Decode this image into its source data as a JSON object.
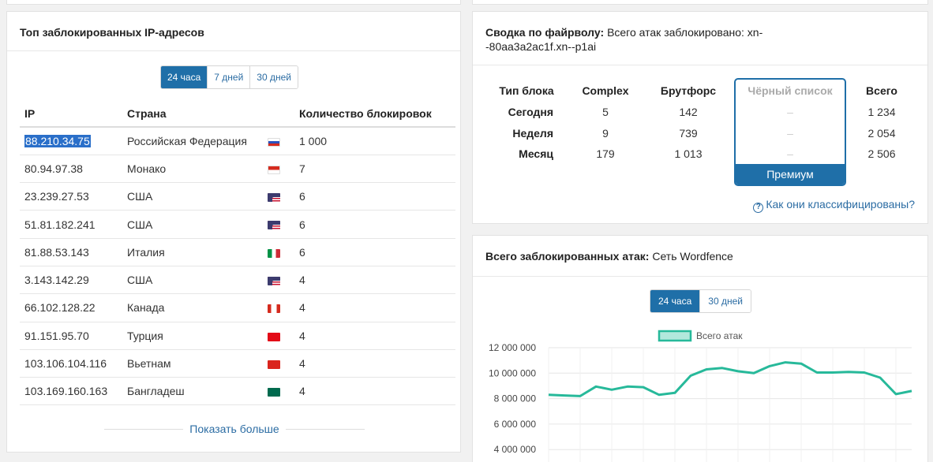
{
  "left_card": {
    "title": "Топ заблокированных IP-адресов",
    "range_tabs": [
      "24 часа",
      "7 дней",
      "30 дней"
    ],
    "active_tab": 0,
    "columns": [
      "IP",
      "Страна",
      "Количество блокировок"
    ],
    "rows": [
      {
        "ip": "88.210.34.75",
        "country": "Российская Федерация",
        "flag": "ru",
        "count": "1 000"
      },
      {
        "ip": "80.94.97.38",
        "country": "Монако",
        "flag": "mc",
        "count": "7"
      },
      {
        "ip": "23.239.27.53",
        "country": "США",
        "flag": "us",
        "count": "6"
      },
      {
        "ip": "51.81.182.241",
        "country": "США",
        "flag": "us",
        "count": "6"
      },
      {
        "ip": "81.88.53.143",
        "country": "Италия",
        "flag": "it",
        "count": "6"
      },
      {
        "ip": "3.143.142.29",
        "country": "США",
        "flag": "us",
        "count": "4"
      },
      {
        "ip": "66.102.128.22",
        "country": "Канада",
        "flag": "ca",
        "count": "4"
      },
      {
        "ip": "91.151.95.70",
        "country": "Турция",
        "flag": "tr",
        "count": "4"
      },
      {
        "ip": "103.106.104.116",
        "country": "Вьетнам",
        "flag": "vn",
        "count": "4"
      },
      {
        "ip": "103.169.160.163",
        "country": "Бангладеш",
        "flag": "bd",
        "count": "4"
      }
    ],
    "show_more": "Показать больше"
  },
  "firewall": {
    "title_bold": "Сводка по файрволу:",
    "title_rest": "Всего атак заблокировано: xn--80aa3a2ac1f.xn--p1ai",
    "title_line1": "Всего атак заблокировано: xn-",
    "title_line2": "-80aa3a2ac1f.xn--p1ai",
    "headers": [
      "Тип блока",
      "Complex",
      "Брутфорс",
      "Чёрный список",
      "Всего"
    ],
    "rows": [
      {
        "label": "Сегодня",
        "complex": "5",
        "brute": "142",
        "blacklist": "–",
        "total": "1 234"
      },
      {
        "label": "Неделя",
        "complex": "9",
        "brute": "739",
        "blacklist": "–",
        "total": "2 054"
      },
      {
        "label": "Месяц",
        "complex": "179",
        "brute": "1 013",
        "blacklist": "–",
        "total": "2 506"
      }
    ],
    "premium_label": "Премиум",
    "help_link": "Как они классифицированы?"
  },
  "attacks": {
    "title_bold": "Всего заблокированных атак:",
    "title_rest": "Сеть Wordfence",
    "range_tabs": [
      "24 часа",
      "30 дней"
    ],
    "active_tab": 0
  },
  "colors": {
    "accent": "#1f6fa8",
    "link": "#2b6ca3",
    "line": "#27b99a",
    "legend_fill": "#b2e8dc"
  },
  "chart_data": {
    "type": "line",
    "series": [
      {
        "name": "Всего атак",
        "values": [
          8300000,
          8250000,
          8200000,
          8950000,
          8700000,
          8950000,
          8900000,
          8300000,
          8450000,
          9800000,
          10300000,
          10400000,
          10150000,
          10000000,
          10550000,
          10850000,
          10750000,
          10050000,
          10050000,
          10100000,
          10050000,
          9650000,
          8350000,
          8600000
        ]
      }
    ],
    "yticks": [
      "12 000 000",
      "10 000 000",
      "8 000 000",
      "6 000 000",
      "4 000 000"
    ],
    "ylim": [
      4000000,
      12000000
    ],
    "grid": true,
    "legend": "top"
  }
}
